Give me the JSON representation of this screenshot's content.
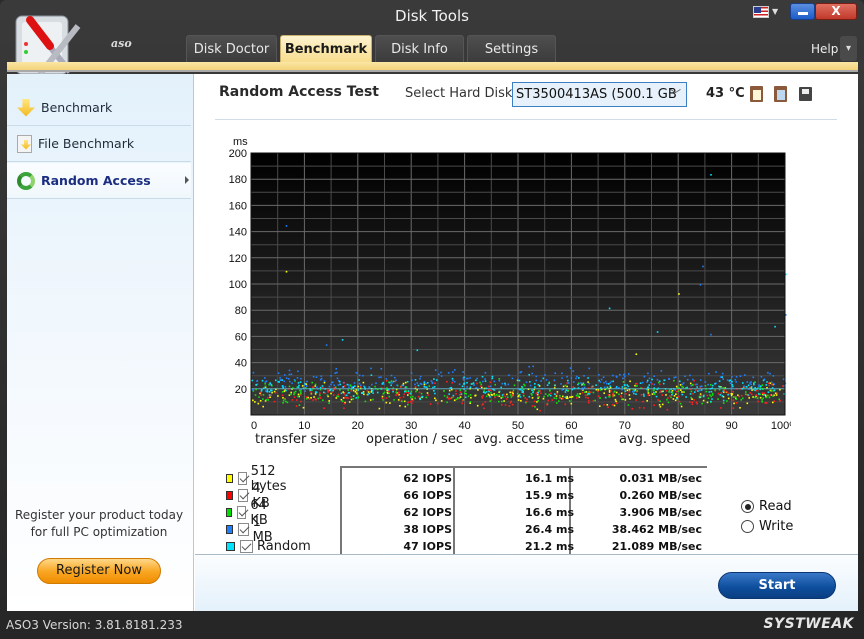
{
  "window": {
    "title": "Disk Tools",
    "logo_text": "aso",
    "close_glyph": "X"
  },
  "tabs": [
    {
      "label": "Disk Doctor",
      "active": false
    },
    {
      "label": "Benchmark",
      "active": true
    },
    {
      "label": "Disk Info",
      "active": false
    },
    {
      "label": "Settings",
      "active": false
    }
  ],
  "help": {
    "label": "Help",
    "menu_glyph": "▾"
  },
  "sidebar": {
    "items": [
      {
        "label": "Benchmark",
        "icon": "down-arrow-icon",
        "active": false
      },
      {
        "label": "File Benchmark",
        "icon": "file-arrow-icon",
        "active": false
      },
      {
        "label": "Random Access",
        "icon": "refresh-icon",
        "active": true
      }
    ],
    "register_text_1": "Register your product today",
    "register_text_2": "for full PC optimization",
    "register_button": "Register Now"
  },
  "main": {
    "title": "Random Access Test",
    "disk_label": "Select Hard Disk:",
    "disk_value": "ST3500413AS (500.1 GB",
    "temperature": "43 °C",
    "column_headers": [
      "transfer size",
      "operation / sec",
      "avg. access time",
      "avg. speed"
    ],
    "results": [
      {
        "label": "512 bytes",
        "color": "#ffff00",
        "checked": true,
        "iops": "62 IOPS",
        "access": "16.1 ms",
        "speed": "0.031 MB/sec"
      },
      {
        "label": "4 KB",
        "color": "#ff0000",
        "checked": true,
        "iops": "66 IOPS",
        "access": "15.9 ms",
        "speed": "0.260 MB/sec"
      },
      {
        "label": "64 KB",
        "color": "#00dd00",
        "checked": true,
        "iops": "62 IOPS",
        "access": "16.6 ms",
        "speed": "3.906 MB/sec"
      },
      {
        "label": "1 MB",
        "color": "#1e7fff",
        "checked": true,
        "iops": "38 IOPS",
        "access": "26.4 ms",
        "speed": "38.462 MB/sec"
      },
      {
        "label": "Random",
        "color": "#00e5ff",
        "checked": true,
        "iops": "47 IOPS",
        "access": "21.2 ms",
        "speed": "21.089 MB/sec"
      }
    ],
    "mode": {
      "options": [
        "Read",
        "Write"
      ],
      "selected": "Read"
    },
    "start_button": "Start"
  },
  "status": {
    "version": "ASO3 Version: 3.81.8181.233",
    "brand": "SYSTWEAK"
  },
  "chart_data": {
    "type": "scatter",
    "title": "",
    "xlabel": "",
    "ylabel": "ms",
    "xlim": [
      0,
      100
    ],
    "ylim": [
      0,
      200
    ],
    "x_ticks": [
      "0",
      "10",
      "20",
      "30",
      "40",
      "50",
      "60",
      "70",
      "80",
      "90",
      "100%"
    ],
    "y_ticks": [
      "20",
      "40",
      "60",
      "80",
      "100",
      "120",
      "140",
      "160",
      "180",
      "200"
    ],
    "grid": true,
    "legend": "bottom-left",
    "series": [
      {
        "name": "512 bytes",
        "color": "#ffff00",
        "mean_ms": 16.1,
        "spread_ms": [
          3,
          30
        ]
      },
      {
        "name": "4 KB",
        "color": "#ff2020",
        "mean_ms": 15.9,
        "spread_ms": [
          2,
          30
        ]
      },
      {
        "name": "64 KB",
        "color": "#10e010",
        "mean_ms": 16.6,
        "spread_ms": [
          3,
          30
        ]
      },
      {
        "name": "1 MB",
        "color": "#1e7fff",
        "mean_ms": 26.4,
        "spread_ms": [
          15,
          40
        ]
      },
      {
        "name": "Random",
        "color": "#00e5ff",
        "mean_ms": 21.2,
        "spread_ms": [
          8,
          35
        ]
      }
    ],
    "outliers": [
      {
        "series": "1 MB",
        "x": 6.5,
        "y": 145
      },
      {
        "series": "512 bytes",
        "x": 6.5,
        "y": 110
      },
      {
        "series": "Random",
        "x": 86,
        "y": 184
      },
      {
        "series": "1 MB",
        "x": 84.5,
        "y": 114
      },
      {
        "series": "1 MB",
        "x": 84,
        "y": 100
      },
      {
        "series": "512 bytes",
        "x": 80,
        "y": 93
      },
      {
        "series": "Random",
        "x": 100,
        "y": 108
      },
      {
        "series": "1 MB",
        "x": 100,
        "y": 77
      },
      {
        "series": "Random",
        "x": 98,
        "y": 68
      },
      {
        "series": "1 MB",
        "x": 86,
        "y": 62
      },
      {
        "series": "Random",
        "x": 67,
        "y": 82
      },
      {
        "series": "Random",
        "x": 76,
        "y": 64
      },
      {
        "series": "1 MB",
        "x": 14,
        "y": 54
      },
      {
        "series": "Random",
        "x": 17,
        "y": 58
      },
      {
        "series": "Random",
        "x": 31,
        "y": 50
      },
      {
        "series": "512 bytes",
        "x": 72,
        "y": 47
      }
    ]
  }
}
